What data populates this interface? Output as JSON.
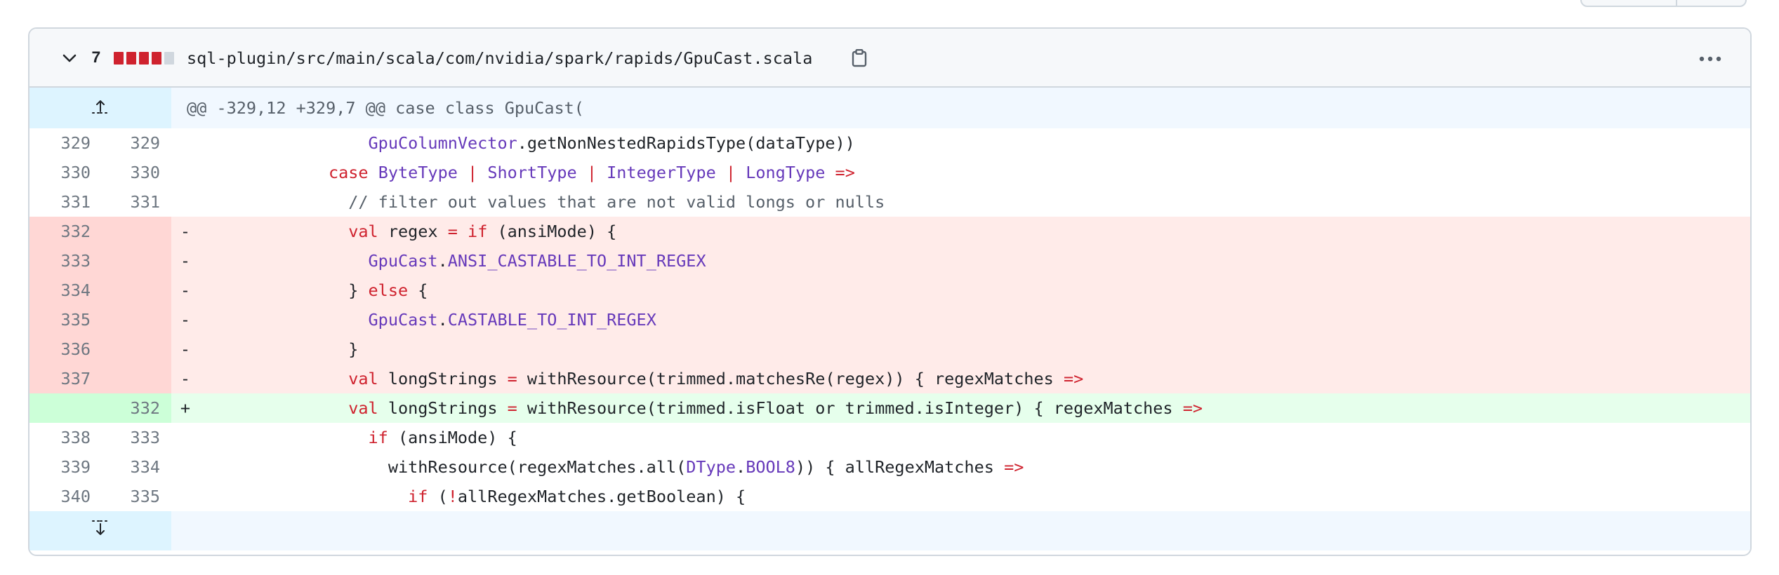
{
  "file": {
    "changes_count": "7",
    "diffstat": [
      "del",
      "del",
      "del",
      "del",
      "neutral"
    ],
    "path": "sql-plugin/src/main/scala/com/nvidia/spark/rapids/GpuCast.scala",
    "colors": {
      "del_block": "#cf222e",
      "neutral_block": "#d0d7de"
    }
  },
  "hunk": {
    "header": "@@ -329,12 +329,7 @@ case class GpuCast("
  },
  "lines": [
    {
      "type": "ctx",
      "old": "329",
      "new": "329",
      "indent": "                 ",
      "tokens": [
        {
          "t": "GpuColumnVector",
          "c": "ty"
        },
        {
          "t": ".getNonNestedRapidsType(dataType))",
          "c": ""
        }
      ]
    },
    {
      "type": "ctx",
      "old": "330",
      "new": "330",
      "indent": "             ",
      "tokens": [
        {
          "t": "case ",
          "c": "kw"
        },
        {
          "t": "ByteType",
          "c": "ty"
        },
        {
          "t": " | ",
          "c": "kw"
        },
        {
          "t": "ShortType",
          "c": "ty"
        },
        {
          "t": " | ",
          "c": "kw"
        },
        {
          "t": "IntegerType",
          "c": "ty"
        },
        {
          "t": " | ",
          "c": "kw"
        },
        {
          "t": "LongType",
          "c": "ty"
        },
        {
          "t": " =>",
          "c": "kw"
        }
      ]
    },
    {
      "type": "ctx",
      "old": "331",
      "new": "331",
      "indent": "               ",
      "tokens": [
        {
          "t": "// filter out values that are not valid longs or nulls",
          "c": "cm"
        }
      ]
    },
    {
      "type": "del",
      "old": "332",
      "new": "",
      "indent": "               ",
      "tokens": [
        {
          "t": "val",
          "c": "kw"
        },
        {
          "t": " regex ",
          "c": ""
        },
        {
          "t": "=",
          "c": "kw"
        },
        {
          "t": " ",
          "c": ""
        },
        {
          "t": "if",
          "c": "kw"
        },
        {
          "t": " (ansiMode) {",
          "c": ""
        }
      ]
    },
    {
      "type": "del",
      "old": "333",
      "new": "",
      "indent": "                 ",
      "tokens": [
        {
          "t": "GpuCast",
          "c": "ty"
        },
        {
          "t": ".",
          "c": ""
        },
        {
          "t": "ANSI_CASTABLE_TO_INT_REGEX",
          "c": "ty"
        }
      ]
    },
    {
      "type": "del",
      "old": "334",
      "new": "",
      "indent": "               ",
      "tokens": [
        {
          "t": "} ",
          "c": ""
        },
        {
          "t": "else",
          "c": "kw"
        },
        {
          "t": " {",
          "c": ""
        }
      ]
    },
    {
      "type": "del",
      "old": "335",
      "new": "",
      "indent": "                 ",
      "tokens": [
        {
          "t": "GpuCast",
          "c": "ty"
        },
        {
          "t": ".",
          "c": ""
        },
        {
          "t": "CASTABLE_TO_INT_REGEX",
          "c": "ty"
        }
      ]
    },
    {
      "type": "del",
      "old": "336",
      "new": "",
      "indent": "               ",
      "tokens": [
        {
          "t": "}",
          "c": ""
        }
      ]
    },
    {
      "type": "del",
      "old": "337",
      "new": "",
      "indent": "               ",
      "tokens": [
        {
          "t": "val",
          "c": "kw"
        },
        {
          "t": " longStrings ",
          "c": ""
        },
        {
          "t": "=",
          "c": "kw"
        },
        {
          "t": " withResource(trimmed.matchesRe(regex)) { regexMatches ",
          "c": ""
        },
        {
          "t": "=>",
          "c": "kw"
        }
      ]
    },
    {
      "type": "add",
      "old": "",
      "new": "332",
      "indent": "               ",
      "tokens": [
        {
          "t": "val",
          "c": "kw"
        },
        {
          "t": " longStrings ",
          "c": ""
        },
        {
          "t": "=",
          "c": "kw"
        },
        {
          "t": " withResource(trimmed.isFloat or trimmed.isInteger) { regexMatches ",
          "c": ""
        },
        {
          "t": "=>",
          "c": "kw"
        }
      ]
    },
    {
      "type": "ctx",
      "old": "338",
      "new": "333",
      "indent": "                 ",
      "tokens": [
        {
          "t": "if",
          "c": "kw"
        },
        {
          "t": " (ansiMode) {",
          "c": ""
        }
      ]
    },
    {
      "type": "ctx",
      "old": "339",
      "new": "334",
      "indent": "                   ",
      "tokens": [
        {
          "t": "withResource(regexMatches.all(",
          "c": ""
        },
        {
          "t": "DType",
          "c": "ty"
        },
        {
          "t": ".",
          "c": ""
        },
        {
          "t": "BOOL8",
          "c": "ty"
        },
        {
          "t": ")) { allRegexMatches ",
          "c": ""
        },
        {
          "t": "=>",
          "c": "kw"
        }
      ]
    },
    {
      "type": "ctx",
      "old": "340",
      "new": "335",
      "indent": "                     ",
      "tokens": [
        {
          "t": "if",
          "c": "kw"
        },
        {
          "t": " (",
          "c": ""
        },
        {
          "t": "!",
          "c": "kw"
        },
        {
          "t": "allRegexMatches.getBoolean) {",
          "c": ""
        }
      ]
    }
  ],
  "markers": {
    "del": "-",
    "add": "+",
    "ctx": " "
  },
  "icons": {
    "collapse": "chevron-down-icon",
    "copy": "clipboard-icon",
    "more": "kebab-horizontal-icon",
    "expand_up": "fold-up-icon",
    "expand_down": "fold-down-icon"
  }
}
